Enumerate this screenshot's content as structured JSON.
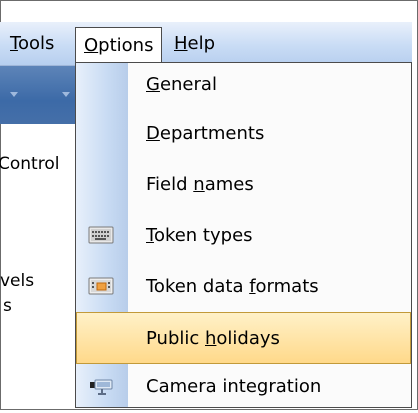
{
  "menubar": {
    "tools": {
      "before": "",
      "accel": "T",
      "after": "ools"
    },
    "options": {
      "before": "",
      "accel": "O",
      "after": "ptions"
    },
    "help": {
      "before": "",
      "accel": "H",
      "after": "elp"
    }
  },
  "background": {
    "control_label": "Control",
    "vels_label": "vels",
    "s_label": "s"
  },
  "options_menu": {
    "items": [
      {
        "before": "",
        "accel": "G",
        "after": "eneral",
        "icon": "none"
      },
      {
        "before": "",
        "accel": "D",
        "after": "epartments",
        "icon": "none"
      },
      {
        "before": "Field ",
        "accel": "n",
        "after": "ames",
        "icon": "none"
      },
      {
        "before": "",
        "accel": "T",
        "after": "oken types",
        "icon": "keyboard-icon"
      },
      {
        "before": "Token data ",
        "accel": "f",
        "after": "ormats",
        "icon": "card-icon"
      },
      {
        "before": "Public ",
        "accel": "h",
        "after": "olidays",
        "icon": "none",
        "highlighted": true
      },
      {
        "before": "Camera integration",
        "accel": "",
        "after": "",
        "icon": "camera-icon"
      }
    ]
  },
  "colors": {
    "menubar": "#c9dcf5",
    "highlight": "#ffd98a",
    "gutter": "#c8dbf3"
  }
}
